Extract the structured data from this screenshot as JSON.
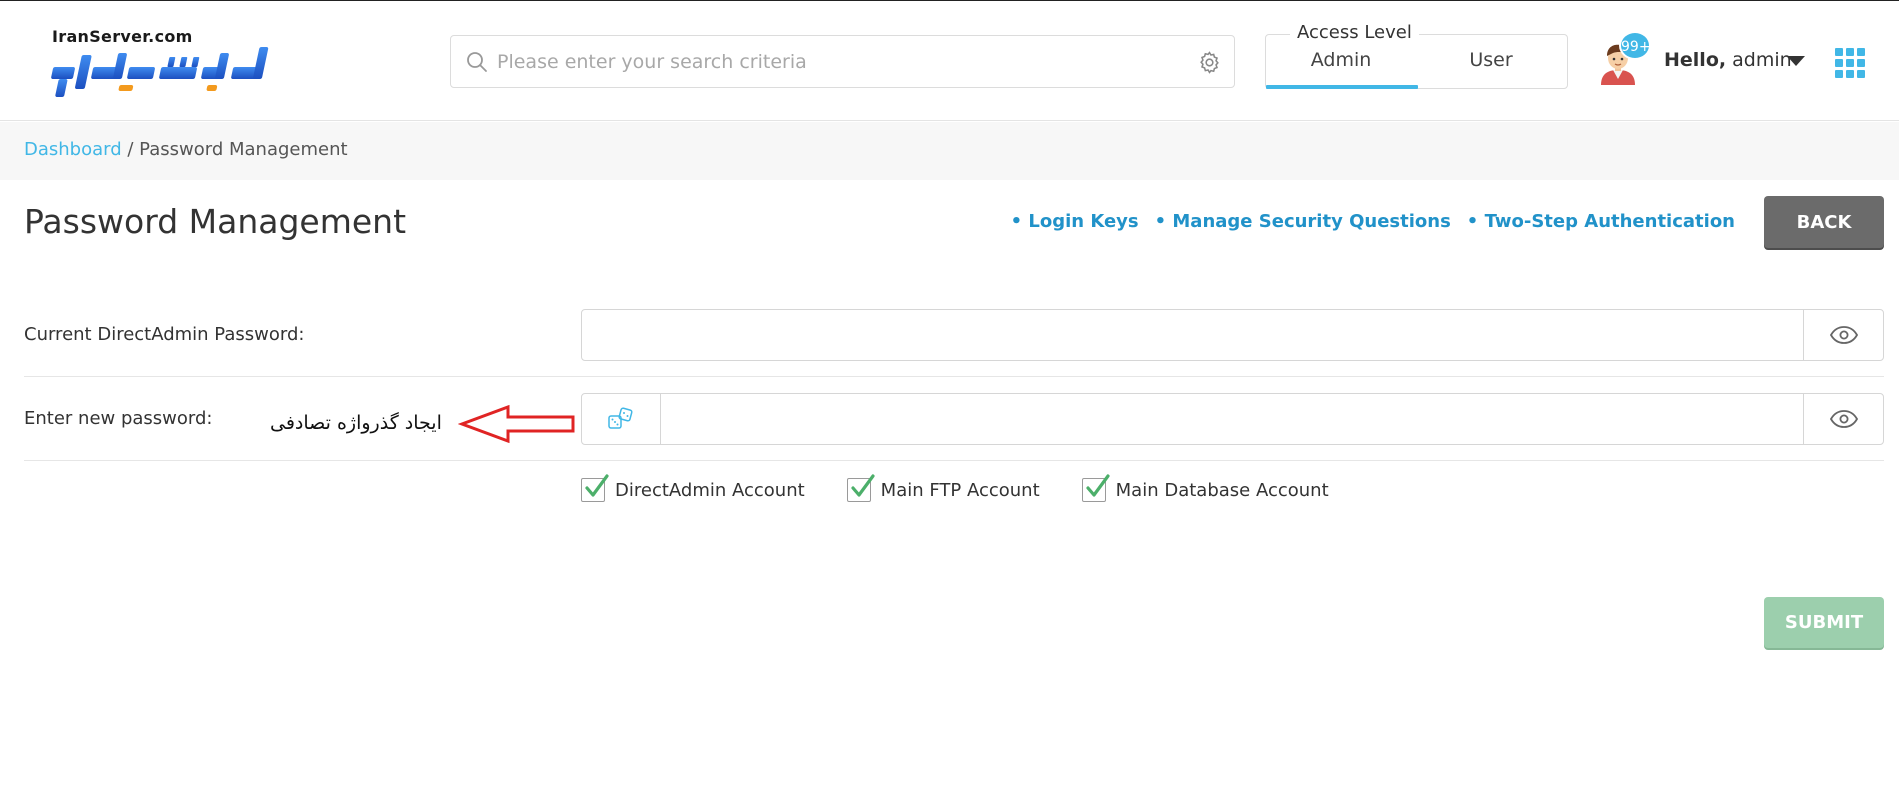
{
  "header": {
    "logo_domain": "IranServer.com",
    "logo_name": "ایران سرور",
    "search_placeholder": "Please enter your search criteria",
    "access_level": {
      "legend": "Access Level",
      "tabs": [
        "Admin",
        "User"
      ],
      "active": "Admin"
    },
    "notification_count": "99+",
    "greeting": "Hello,",
    "username": "admin",
    "icons": [
      "search-icon",
      "gear-icon",
      "avatar",
      "chevron-down-icon",
      "apps-grid-icon"
    ]
  },
  "breadcrumb": {
    "root": "Dashboard",
    "separator": " / ",
    "current": "Password Management"
  },
  "page": {
    "title": "Password Management",
    "links": [
      "• Login Keys",
      "• Manage Security Questions",
      "• Two-Step Authentication"
    ],
    "back_label": "BACK"
  },
  "form": {
    "current_password_label": "Current DirectAdmin Password:",
    "current_password_value": "",
    "new_password_label": "Enter new password:",
    "new_password_value": "",
    "random_hint": "ایجاد گذرواژه تصادفی",
    "checkboxes": [
      {
        "label": "DirectAdmin Account",
        "checked": true
      },
      {
        "label": "Main FTP Account",
        "checked": true
      },
      {
        "label": "Main Database Account",
        "checked": true
      }
    ],
    "submit_label": "SUBMIT"
  },
  "colors": {
    "accent": "#41b7e6",
    "link": "#2192c9",
    "back_button": "#6b6b6b",
    "submit_button": "#9ccfad",
    "check": "#4caf6a",
    "annotation_arrow": "#e02424",
    "logo_blue": "#1f5fd1",
    "logo_orange": "#f39a1e"
  }
}
